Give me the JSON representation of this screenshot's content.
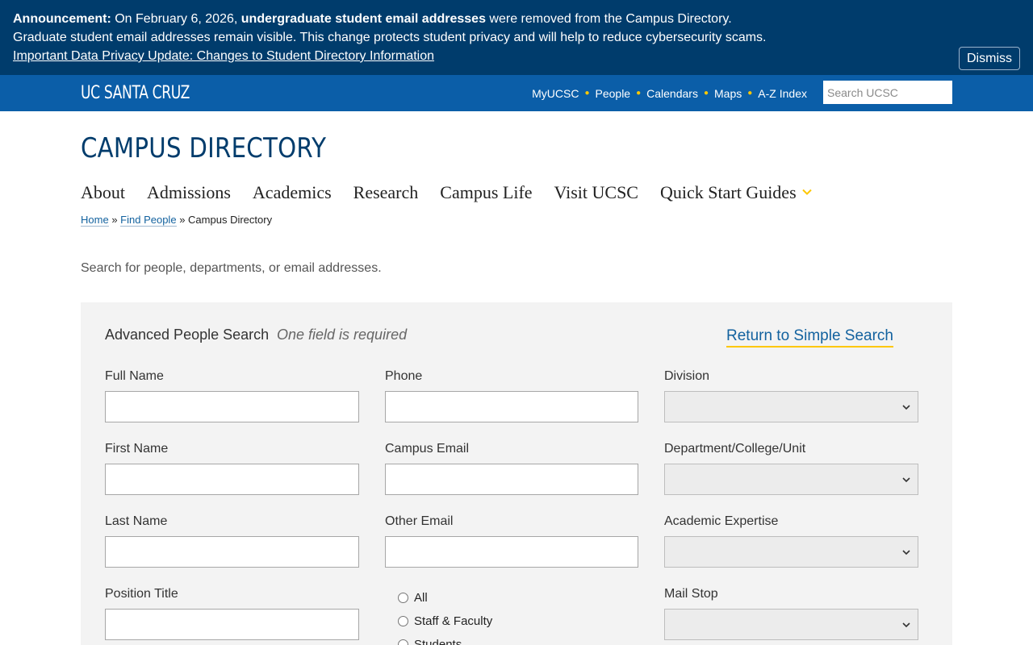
{
  "announcement": {
    "label": "Announcement:",
    "text1": " On February 6, 2026, ",
    "bold": "undergraduate student email addresses",
    "text2": " were removed from the Campus Directory.",
    "line2": "Graduate student email addresses remain visible. This change protects student privacy and will help to reduce cybersecurity scams.",
    "link": "Important Data Privacy Update: Changes to Student Directory Information",
    "dismiss": "Dismiss"
  },
  "topbar": {
    "logo": "UC SANTA CRUZ",
    "links": [
      "MyUCSC",
      "People",
      "Calendars",
      "Maps",
      "A-Z Index"
    ],
    "search_placeholder": "Search UCSC"
  },
  "page_title": "CAMPUS DIRECTORY",
  "nav": {
    "items": [
      "About",
      "Admissions",
      "Academics",
      "Research",
      "Campus Life",
      "Visit UCSC"
    ],
    "quick_start": "Quick Start Guides"
  },
  "breadcrumb": {
    "home": "Home",
    "sep": "»",
    "find_people": "Find People",
    "current": "Campus Directory"
  },
  "intro": "Search for people, departments, or email addresses.",
  "search": {
    "heading": "Advanced People Search",
    "required": "One field is required",
    "return_link": "Return to Simple Search",
    "fields": {
      "full_name": "Full Name",
      "phone": "Phone",
      "division": "Division",
      "first_name": "First Name",
      "campus_email": "Campus Email",
      "department": "Department/College/Unit",
      "last_name": "Last Name",
      "other_email": "Other Email",
      "expertise": "Academic Expertise",
      "position_title": "Position Title",
      "mail_stop": "Mail Stop"
    },
    "radios": [
      "All",
      "Staff & Faculty",
      "Students"
    ]
  },
  "colors": {
    "banner": "#003c6c",
    "topbar": "#0b5ea8",
    "accent_gold": "#fdc700",
    "link": "#13629f"
  }
}
